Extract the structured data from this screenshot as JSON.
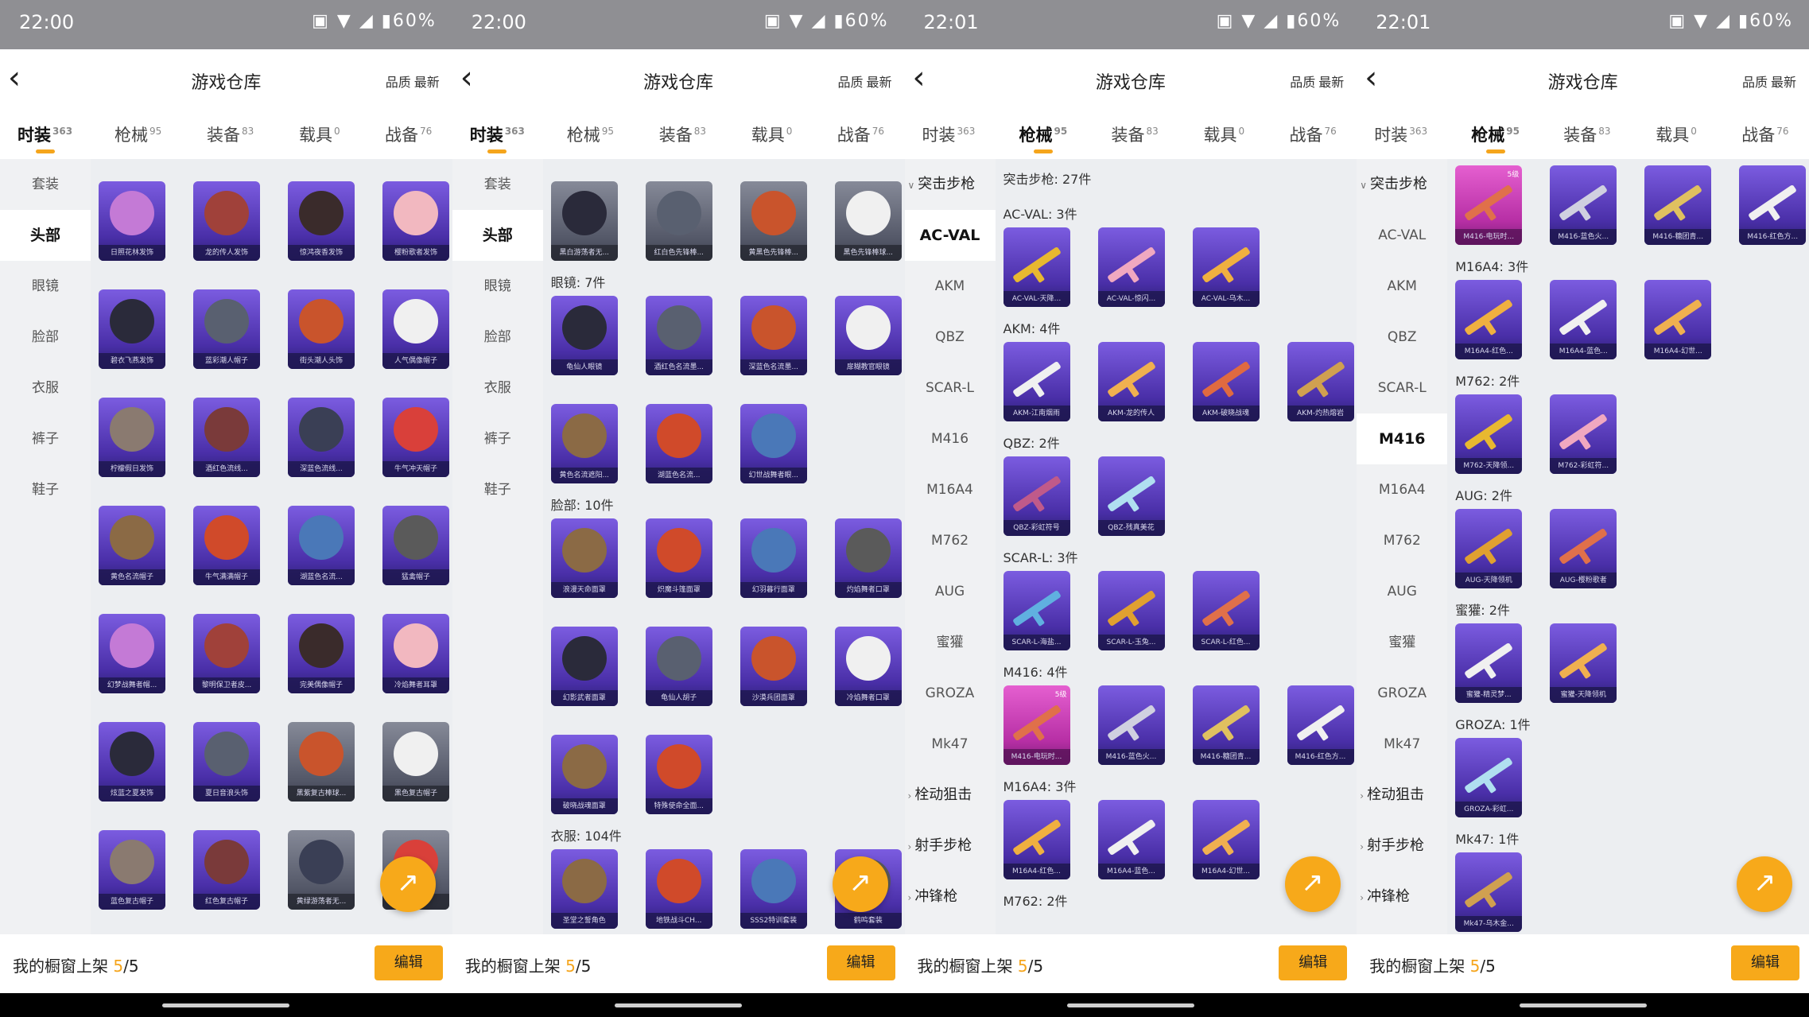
{
  "colors": {
    "accent": "#f5a51c",
    "tile_purple": "#5a3ec4",
    "tile_grey": "#60646f",
    "tile_pink": "#c93cb8"
  },
  "screens": [
    {
      "status": {
        "time": "22:00",
        "icons": "▣ ▼ ◢ ▮60%"
      },
      "title": "游戏仓库",
      "filter_quality": "品质",
      "filter_newest": "最新",
      "back_icon": "‹",
      "tabs": [
        {
          "label": "时装",
          "count": "363",
          "active": true
        },
        {
          "label": "枪械",
          "count": "95"
        },
        {
          "label": "装备",
          "count": "83"
        },
        {
          "label": "载具",
          "count": "0"
        },
        {
          "label": "战备",
          "count": "76"
        }
      ],
      "sidebar": [
        "套装",
        "头部",
        "眼镜",
        "脸部",
        "衣服",
        "裤子",
        "鞋子"
      ],
      "sidebar_active": 1,
      "sections": [],
      "tiles": [
        "日照花林发饰",
        "龙的传人发饰",
        "惊鸿夜香发饰",
        "樱粉歌者发饰",
        "碧衣飞燕发饰",
        "蓝彩潮人帽子",
        "街头潮人头饰",
        "人气偶像帽子",
        "柠檬假日发饰",
        "酒红色流线...",
        "深蓝色流线...",
        "牛气冲天帽子",
        "黄色名流帽子",
        "牛气满满帽子",
        "湖蓝色名流...",
        "猛禽帽子",
        "幻梦战舞者帽...",
        "黎明保卫者皮...",
        "完美偶像帽子",
        "冷焰舞者耳罩",
        "炫蓝之夏发饰",
        "夏日音浪头饰",
        "黑紫复古棒球...",
        "黑色复古帽子",
        "蓝色复古帽子",
        "红色复古帽子",
        "黄绿游荡者无...",
        ""
      ],
      "grey_tiles": [
        22,
        23,
        26,
        27
      ],
      "fab_icon": "↗",
      "bottom": {
        "shelf_label": "我的橱窗上架",
        "shelf_count": "5",
        "shelf_total": "/5",
        "edit": "编辑"
      }
    },
    {
      "status": {
        "time": "22:00",
        "icons": "▣ ▼ ◢ ▮60%"
      },
      "title": "游戏仓库",
      "filter_quality": "品质",
      "filter_newest": "最新",
      "back_icon": "‹",
      "tabs": [
        {
          "label": "时装",
          "count": "363",
          "active": true
        },
        {
          "label": "枪械",
          "count": "95"
        },
        {
          "label": "装备",
          "count": "83"
        },
        {
          "label": "载具",
          "count": "0"
        },
        {
          "label": "战备",
          "count": "76"
        }
      ],
      "sidebar": [
        "套装",
        "头部",
        "眼镜",
        "脸部",
        "衣服",
        "裤子",
        "鞋子"
      ],
      "sidebar_active": 1,
      "sections": [
        "眼镜: 7件",
        "脸部: 10件",
        "衣服: 104件"
      ],
      "row0": [
        "黑白游荡者无...",
        "红白色先锋棒...",
        "黄黑色先锋棒...",
        "黑色先锋棒球..."
      ],
      "row1": [
        "龟仙人眼镜",
        "酒红色名流墨...",
        "深蓝色名流墨...",
        "扉糊教官眼镜"
      ],
      "row2": [
        "黄色名流遮阳...",
        "湖蓝色名流...",
        "幻世战舞者眼..."
      ],
      "row3": [
        "浪漫天命面罩",
        "炽魔斗篷面罩",
        "幻羽暮行面罩",
        "灼焰舞者口罩"
      ],
      "row4": [
        "幻影武者面罩",
        "龟仙人胡子",
        "沙漠兵团面罩",
        "冷焰舞者口罩"
      ],
      "row5": [
        "破晓战魂面罩",
        "特殊使命全面..."
      ],
      "row6": [
        "圣堂之誓角色",
        "地铁战斗CH...",
        "SSS2特训套装",
        "鹤鸣套装"
      ],
      "fab_icon": "↗",
      "bottom": {
        "shelf_label": "我的橱窗上架",
        "shelf_count": "5",
        "shelf_total": "/5",
        "edit": "编辑"
      }
    },
    {
      "status": {
        "time": "22:01",
        "icons": "▣ ▼ ◢ ▮60%"
      },
      "title": "游戏仓库",
      "filter_quality": "品质",
      "filter_newest": "最新",
      "back_icon": "‹",
      "tabs": [
        {
          "label": "时装",
          "count": "363"
        },
        {
          "label": "枪械",
          "count": "95",
          "active": true
        },
        {
          "label": "装备",
          "count": "83"
        },
        {
          "label": "载具",
          "count": "0"
        },
        {
          "label": "战备",
          "count": "76"
        }
      ],
      "sidebar_groups": [
        "突击步枪",
        "栓动狙击",
        "射手步枪",
        "冲锋枪"
      ],
      "sidebar": [
        "AC-VAL",
        "AKM",
        "QBZ",
        "SCAR-L",
        "M416",
        "M16A4",
        "M762",
        "AUG",
        "蜜獾",
        "GROZA",
        "Mk47"
      ],
      "sidebar_active": 0,
      "sections": [
        "突击步枪: 27件",
        "AC-VAL: 3件",
        "AKM: 4件",
        "QBZ: 2件",
        "SCAR-L: 3件",
        "M416: 4件",
        "M16A4: 3件",
        "M762: 2件"
      ],
      "acval": [
        "AC-VAL-天降...",
        "AC-VAL-惊闪...",
        "AC-VAL-乌木..."
      ],
      "akm": [
        "AKM-江南烟雨",
        "AKM-龙的传人",
        "AKM-破晓战魂",
        "AKM-灼热熔岩"
      ],
      "qbz": [
        "QBZ-彩虹符号",
        "QBZ-残真美花"
      ],
      "scarl": [
        "SCAR-L-海盐...",
        "SCAR-L-玉兔...",
        "SCAR-L-红色..."
      ],
      "m416": [
        "M416-电玩时...",
        "M416-蓝色火...",
        "M416-糖团青...",
        "M416-红色方..."
      ],
      "m16a4": [
        "M16A4-红色...",
        "M16A4-蓝色...",
        "M16A4-幻世..."
      ],
      "level_badge": "5级",
      "fab_icon": "↗",
      "bottom": {
        "shelf_label": "我的橱窗上架",
        "shelf_count": "5",
        "shelf_total": "/5",
        "edit": "编辑"
      }
    },
    {
      "status": {
        "time": "22:01",
        "icons": "▣ ▼ ◢ ▮60%"
      },
      "title": "游戏仓库",
      "filter_quality": "品质",
      "filter_newest": "最新",
      "back_icon": "‹",
      "tabs": [
        {
          "label": "时装",
          "count": "363"
        },
        {
          "label": "枪械",
          "count": "95",
          "active": true
        },
        {
          "label": "装备",
          "count": "83"
        },
        {
          "label": "载具",
          "count": "0"
        },
        {
          "label": "战备",
          "count": "76"
        }
      ],
      "sidebar_groups": [
        "突击步枪",
        "栓动狙击",
        "射手步枪",
        "冲锋枪"
      ],
      "sidebar": [
        "AC-VAL",
        "AKM",
        "QBZ",
        "SCAR-L",
        "M416",
        "M16A4",
        "M762",
        "AUG",
        "蜜獾",
        "GROZA",
        "Mk47"
      ],
      "sidebar_active": 4,
      "sections": [
        "M16A4: 3件",
        "M762: 2件",
        "AUG: 2件",
        "蜜獾: 2件",
        "GROZA: 1件",
        "Mk47: 1件"
      ],
      "m416": [
        "M416-电玩时...",
        "M416-蓝色火...",
        "M416-糖团青...",
        "M416-红色方..."
      ],
      "m16a4": [
        "M16A4-红色...",
        "M16A4-蓝色...",
        "M16A4-幻世..."
      ],
      "m762": [
        "M762-天降领...",
        "M762-彩虹符..."
      ],
      "aug": [
        "AUG-天降领机",
        "AUG-樱粉歌者"
      ],
      "honey": [
        "蜜獾-精灵梦...",
        "蜜獾-天降领机"
      ],
      "groza": [
        "GROZA-彩虹..."
      ],
      "mk47": [
        "Mk47-乌木金..."
      ],
      "level_badge": "5级",
      "fab_icon": "↗",
      "bottom": {
        "shelf_label": "我的橱窗上架",
        "shelf_count": "5",
        "shelf_total": "/5",
        "edit": "编辑"
      }
    }
  ]
}
